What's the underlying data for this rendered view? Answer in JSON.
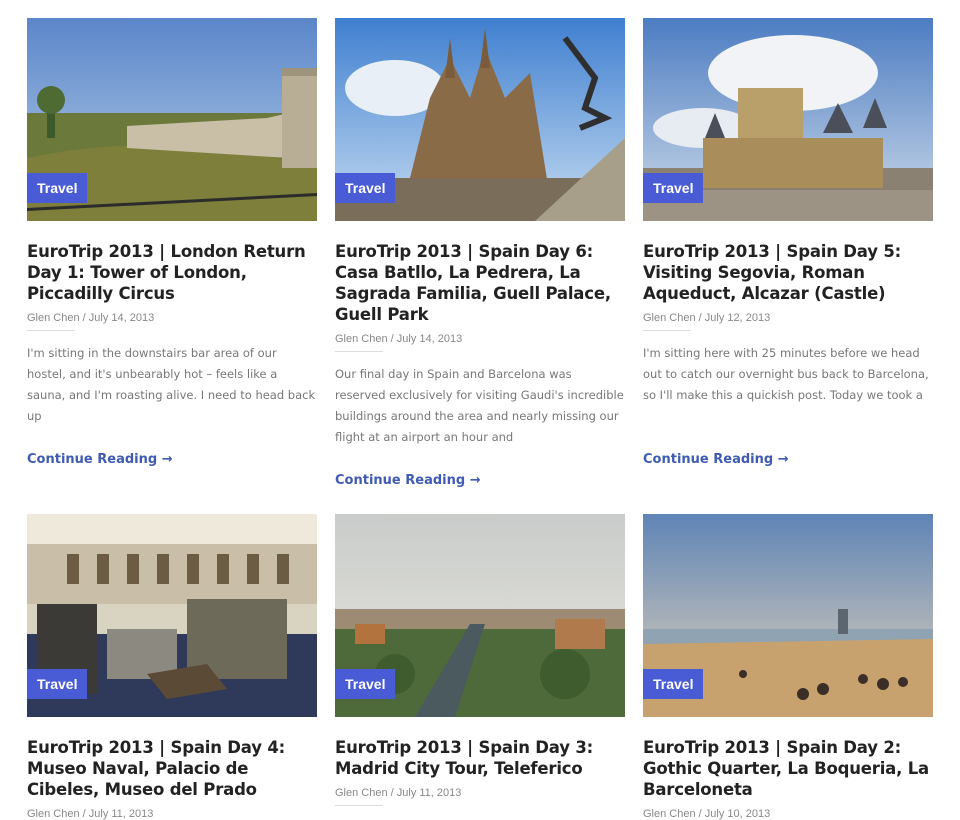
{
  "posts": [
    {
      "category": "Travel",
      "title": "EuroTrip 2013 | London Return Day 1: Tower of London, Piccadilly Circus",
      "author": "Glen Chen",
      "date": "July 14, 2013",
      "excerpt": "I'm sitting in the downstairs bar area of our hostel, and it's unbearably hot – feels like a sauna, and I'm roasting alive. I need to head back up",
      "more": "Continue Reading →"
    },
    {
      "category": "Travel",
      "title": "EuroTrip 2013 | Spain Day 6: Casa Batllo, La Pedrera, La Sagrada Familia, Guell Palace, Guell Park",
      "author": "Glen Chen",
      "date": "July 14, 2013",
      "excerpt": "Our final day in Spain and Barcelona was reserved exclusively for visiting Gaudi's incredible buildings around the area and nearly missing our flight at an airport an hour and",
      "more": "Continue Reading →"
    },
    {
      "category": "Travel",
      "title": "EuroTrip 2013 | Spain Day 5: Visiting Segovia, Roman Aqueduct, Alcazar (Castle)",
      "author": "Glen Chen",
      "date": "July 12, 2013",
      "excerpt": "I'm sitting here with 25 minutes before we head out to catch our overnight bus back to Barcelona, so I'll make this a quickish post. Today we took a",
      "more": "Continue Reading →"
    },
    {
      "category": "Travel",
      "title": "EuroTrip 2013 | Spain Day 4: Museo Naval, Palacio de Cibeles, Museo del Prado",
      "author": "Glen Chen",
      "date": "July 11, 2013"
    },
    {
      "category": "Travel",
      "title": "EuroTrip 2013 | Spain Day 3: Madrid City Tour, Teleferico",
      "author": "Glen Chen",
      "date": "July 11, 2013"
    },
    {
      "category": "Travel",
      "title": "EuroTrip 2013 | Spain Day 2: Gothic Quarter, La Boqueria, La Barceloneta",
      "author": "Glen Chen",
      "date": "July 10, 2013"
    }
  ],
  "meta_separator": " / "
}
